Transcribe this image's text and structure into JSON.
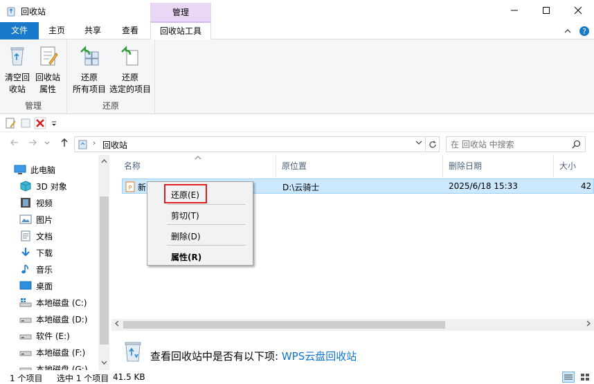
{
  "window": {
    "title": "回收站",
    "context_tab_header": "管理"
  },
  "tabs": {
    "file": "文件",
    "home": "主页",
    "share": "共享",
    "view": "查看",
    "recycle_tools": "回收站工具"
  },
  "ribbon": {
    "groups": {
      "manage": "管理",
      "restore": "还原"
    },
    "buttons": {
      "empty_line1": "清空回",
      "empty_line2": "收站",
      "props_line1": "回收站",
      "props_line2": "属性",
      "restore_all_line1": "还原",
      "restore_all_line2": "所有项目",
      "restore_sel_line1": "还原",
      "restore_sel_line2": "选定的项目"
    }
  },
  "address": {
    "breadcrumb": "回收站",
    "search_placeholder": "在 回收站 中搜索"
  },
  "nav": {
    "items": [
      "此电脑",
      "3D 对象",
      "视频",
      "图片",
      "文档",
      "下载",
      "音乐",
      "桌面",
      "本地磁盘 (C:)",
      "本地磁盘 (D:)",
      "软件 (E:)",
      "本地磁盘 (F:)",
      "本地磁盘 (G:)"
    ]
  },
  "columns": {
    "name": "名称",
    "original_location": "原位置",
    "date_deleted": "删除日期",
    "size": "大小"
  },
  "file_row": {
    "name": "新",
    "original_location": "D:\\云骑士",
    "date_deleted": "2025/6/18 15:33",
    "size": "42"
  },
  "context_menu": {
    "restore": "还原(E)",
    "cut": "剪切(T)",
    "delete": "删除(D)",
    "properties": "属性(R)"
  },
  "wps": {
    "prompt": "查看回收站中是否有以下项: ",
    "link": "WPS云盘回收站"
  },
  "status": {
    "item_count": "1 个项目",
    "selected": "选中 1 个项目",
    "size": "41.5 KB"
  },
  "colors": {
    "accent": "#1979ca",
    "selection": "#cce8ff",
    "context_tab": "#e9d7f5",
    "highlight_box": "#e02020",
    "link": "#0b74d1"
  }
}
